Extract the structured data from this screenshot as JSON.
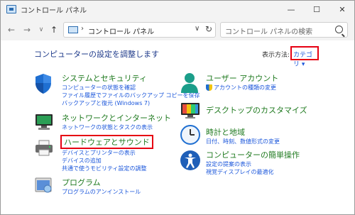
{
  "window": {
    "title": "コントロール パネル"
  },
  "toolbar": {
    "back": "←",
    "forward": "→",
    "dropdown": "∨",
    "up": "↑",
    "address_sep": "›",
    "address": "コントロール パネル",
    "address_chev": "∨",
    "refresh": "↻",
    "search_placeholder": "コントロール パネルの検索"
  },
  "window_buttons": {
    "minimize": "—",
    "maximize": "☐",
    "close": "✕"
  },
  "main": {
    "heading": "コンピューターの設定を調整します",
    "view_by_label": "表示方法:",
    "view_by_value": "カテゴリ ▾"
  },
  "categories_left": [
    {
      "title": "システムとセキュリティ",
      "links": [
        "コンピューターの状態を確認",
        "ファイル履歴でファイルのバックアップ コピーを保存",
        "バックアップと復元 (Windows 7)"
      ]
    },
    {
      "title": "ネットワークとインターネット",
      "links": [
        "ネットワークの状態とタスクの表示"
      ]
    },
    {
      "title": "ハードウェアとサウンド",
      "links": [
        "デバイスとプリンターの表示",
        "デバイスの追加",
        "共通で使うモビリティ設定の調整"
      ]
    },
    {
      "title": "プログラム",
      "links": [
        "プログラムのアンインストール"
      ]
    }
  ],
  "categories_right": [
    {
      "title": "ユーザー アカウント",
      "links": [
        "アカウントの種類の変更"
      ]
    },
    {
      "title": "デスクトップのカスタマイズ",
      "links": []
    },
    {
      "title": "時計と地域",
      "links": [
        "日付、時刻、数値形式の変更"
      ]
    },
    {
      "title": "コンピューターの簡単操作",
      "links": [
        "設定の提案の表示",
        "視覚ディスプレイの最適化"
      ]
    }
  ],
  "colors": {
    "accent_link": "#1a56db",
    "category_title": "#1f7a1f",
    "highlight": "#e60012"
  }
}
